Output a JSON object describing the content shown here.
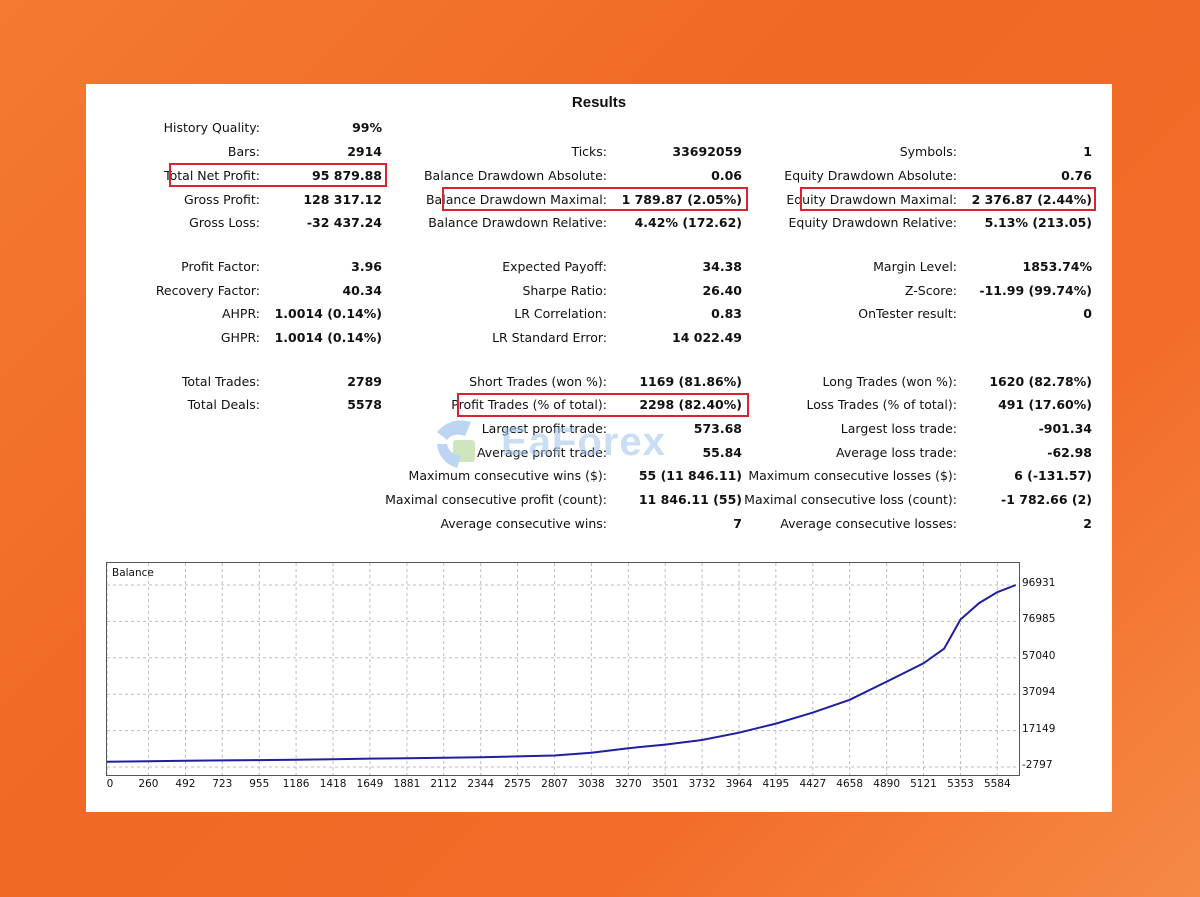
{
  "title": "Results",
  "col1": [
    {
      "label": "History Quality:",
      "value": "99%"
    },
    {
      "label": "Bars:",
      "value": "2914"
    },
    {
      "label": "Total Net Profit:",
      "value": "95 879.88"
    },
    {
      "label": "Gross Profit:",
      "value": "128 317.12"
    },
    {
      "label": "Gross Loss:",
      "value": "-32 437.24"
    },
    {
      "label": "Profit Factor:",
      "value": "3.96"
    },
    {
      "label": "Recovery Factor:",
      "value": "40.34"
    },
    {
      "label": "AHPR:",
      "value": "1.0014 (0.14%)"
    },
    {
      "label": "GHPR:",
      "value": "1.0014 (0.14%)"
    },
    {
      "label": "Total Trades:",
      "value": "2789"
    },
    {
      "label": "Total Deals:",
      "value": "5578"
    }
  ],
  "col2": [
    {
      "label": "Ticks:",
      "value": "33692059"
    },
    {
      "label": "Balance Drawdown Absolute:",
      "value": "0.06"
    },
    {
      "label": "Balance Drawdown Maximal:",
      "value": "1 789.87 (2.05%)"
    },
    {
      "label": "Balance Drawdown Relative:",
      "value": "4.42% (172.62)"
    },
    {
      "label": "Expected Payoff:",
      "value": "34.38"
    },
    {
      "label": "Sharpe Ratio:",
      "value": "26.40"
    },
    {
      "label": "LR Correlation:",
      "value": "0.83"
    },
    {
      "label": "LR Standard Error:",
      "value": "14 022.49"
    },
    {
      "label": "Short Trades (won %):",
      "value": "1169 (81.86%)"
    },
    {
      "label": "Profit Trades (% of total):",
      "value": "2298 (82.40%)"
    },
    {
      "label": "Largest profit trade:",
      "value": "573.68"
    },
    {
      "label": "Average profit trade:",
      "value": "55.84"
    },
    {
      "label": "Maximum consecutive wins ($):",
      "value": "55 (11 846.11)"
    },
    {
      "label": "Maximal consecutive profit (count):",
      "value": "11 846.11 (55)"
    },
    {
      "label": "Average consecutive wins:",
      "value": "7"
    }
  ],
  "col3": [
    {
      "label": "Symbols:",
      "value": "1"
    },
    {
      "label": "Equity Drawdown Absolute:",
      "value": "0.76"
    },
    {
      "label": "Equity Drawdown Maximal:",
      "value": "2 376.87 (2.44%)"
    },
    {
      "label": "Equity Drawdown Relative:",
      "value": "5.13% (213.05)"
    },
    {
      "label": "Margin Level:",
      "value": "1853.74%"
    },
    {
      "label": "Z-Score:",
      "value": "-11.99 (99.74%)"
    },
    {
      "label": "OnTester result:",
      "value": "0"
    },
    {
      "label": "Long Trades (won %):",
      "value": "1620 (82.78%)"
    },
    {
      "label": "Loss Trades (% of total):",
      "value": "491 (17.60%)"
    },
    {
      "label": "Largest loss trade:",
      "value": "-901.34"
    },
    {
      "label": "Average loss trade:",
      "value": "-62.98"
    },
    {
      "label": "Maximum consecutive losses ($):",
      "value": "6 (-131.57)"
    },
    {
      "label": "Maximal consecutive loss (count):",
      "value": "-1 782.66 (2)"
    },
    {
      "label": "Average consecutive losses:",
      "value": "2"
    }
  ],
  "watermark": "EaForex",
  "colors": {
    "background": "#f26b28",
    "highlight": "#d9232e",
    "line": "#1f1fa0",
    "grid": "#bdbdbd"
  },
  "chart_data": {
    "type": "line",
    "title": "Balance",
    "y_ticks": [
      "96931",
      "76985",
      "57040",
      "37094",
      "17149",
      "-2797"
    ],
    "x_ticks": [
      "0",
      "260",
      "492",
      "723",
      "955",
      "1186",
      "1418",
      "1649",
      "1881",
      "2112",
      "2344",
      "2575",
      "2807",
      "3038",
      "3270",
      "3501",
      "3732",
      "3964",
      "4195",
      "4427",
      "4658",
      "4890",
      "5121",
      "5353",
      "5584"
    ],
    "ylim": [
      -2797,
      96931
    ],
    "xlim": [
      0,
      5720
    ],
    "series": [
      {
        "values": [
          [
            0,
            100
          ],
          [
            260,
            300
          ],
          [
            492,
            600
          ],
          [
            723,
            800
          ],
          [
            955,
            1000
          ],
          [
            1186,
            1200
          ],
          [
            1418,
            1500
          ],
          [
            1649,
            1800
          ],
          [
            1881,
            2000
          ],
          [
            2112,
            2300
          ],
          [
            2344,
            2600
          ],
          [
            2575,
            3000
          ],
          [
            2807,
            3500
          ],
          [
            3038,
            5000
          ],
          [
            3270,
            7500
          ],
          [
            3501,
            9500
          ],
          [
            3732,
            12000
          ],
          [
            3964,
            16000
          ],
          [
            4195,
            21000
          ],
          [
            4427,
            27000
          ],
          [
            4658,
            34000
          ],
          [
            4890,
            44000
          ],
          [
            5121,
            54000
          ],
          [
            5250,
            62000
          ],
          [
            5353,
            78000
          ],
          [
            5470,
            87000
          ],
          [
            5584,
            93000
          ],
          [
            5700,
            96931
          ]
        ]
      }
    ],
    "grid": true,
    "line_color": "#1f1fa0"
  }
}
